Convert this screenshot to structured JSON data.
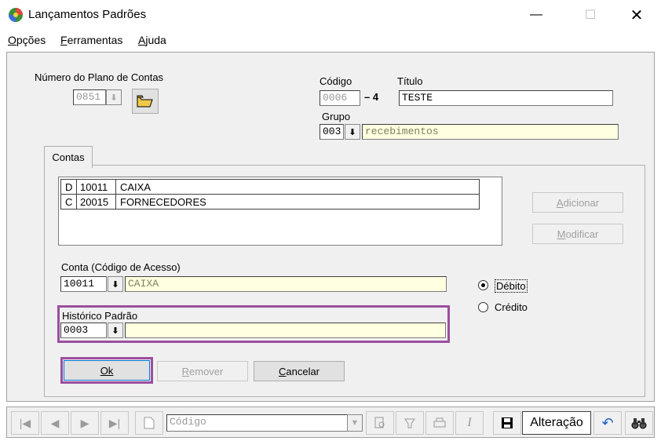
{
  "window": {
    "title": "Lançamentos Padrões",
    "minimize": "—",
    "maximize": "☐",
    "close": "✕"
  },
  "menu": [
    {
      "first": "O",
      "rest": "pções"
    },
    {
      "first": "F",
      "rest": "erramentas"
    },
    {
      "first": "A",
      "rest": "juda"
    }
  ],
  "plano": {
    "label": "Número do Plano de Contas",
    "value": "0851"
  },
  "codigo": {
    "label": "Código",
    "value": "0006",
    "separator": "– 4"
  },
  "titulo": {
    "label": "Título",
    "value": "TESTE"
  },
  "grupo": {
    "label": "Grupo",
    "code": "003",
    "name": "recebimentos"
  },
  "tab": {
    "label": "Contas"
  },
  "accounts": [
    {
      "type": "D",
      "code": "10011",
      "name": "CAIXA"
    },
    {
      "type": "C",
      "code": "20015",
      "name": "FORNECEDORES"
    }
  ],
  "buttons": {
    "adicionar": {
      "first": "A",
      "rest": "dicionar"
    },
    "modificar": {
      "first": "M",
      "rest": "odificar"
    },
    "ok": {
      "first": "Ok",
      "rest": ""
    },
    "remover": {
      "first": "R",
      "rest": "emover"
    },
    "cancelar": {
      "first": "C",
      "rest": "ancelar"
    }
  },
  "conta": {
    "label": "Conta (Código de Acesso)",
    "code": "10011",
    "name": "CAIXA"
  },
  "historico": {
    "label": "Histórico Padrão",
    "code": "0003",
    "text": ""
  },
  "natureza": {
    "debito": "Débito",
    "credito": "Crédito",
    "selected": "debito"
  },
  "toolbar": {
    "search_field": "Código",
    "mode": "Alteração"
  },
  "colors": {
    "highlight": "#9b4ea0",
    "yellow_field": "#ffffe1"
  }
}
